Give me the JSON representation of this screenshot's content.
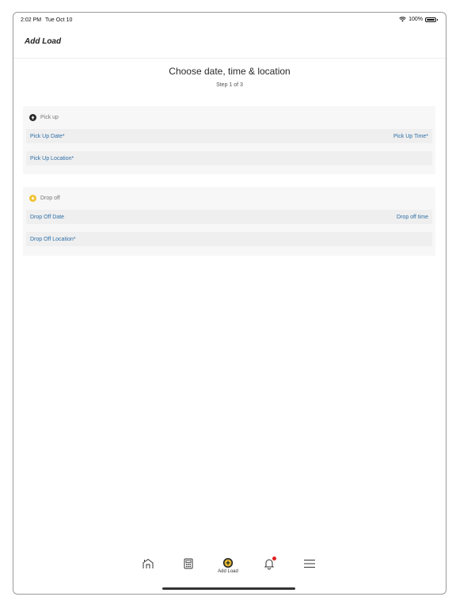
{
  "status_bar": {
    "time": "2:02 PM",
    "date": "Tue Oct 10",
    "battery": "100%"
  },
  "nav": {
    "title": "Add Load"
  },
  "step": {
    "heading": "Choose date, time & location",
    "subheading": "Step 1 of 3"
  },
  "pickup": {
    "section_label": "Pick up",
    "date_label": "Pick Up Date*",
    "time_label": "Pick Up Time*",
    "location_label": "Pick Up Location*"
  },
  "dropoff": {
    "section_label": "Drop off",
    "date_label": "Drop Off Date",
    "time_label": "Drop off time",
    "location_label": "Drop Off Location*"
  },
  "tab_bar": {
    "items": [
      {
        "icon": "home-icon"
      },
      {
        "icon": "calculator-icon"
      },
      {
        "icon": "add-load-icon",
        "label": "Add Load"
      },
      {
        "icon": "bell-icon",
        "has_badge": true
      },
      {
        "icon": "menu-icon"
      }
    ]
  },
  "colors": {
    "accent_yellow": "#f1c232",
    "link_blue": "#2f6fa8",
    "badge_red": "#e02020",
    "card_bg": "#f7f7f7",
    "field_bg": "#efefef"
  }
}
